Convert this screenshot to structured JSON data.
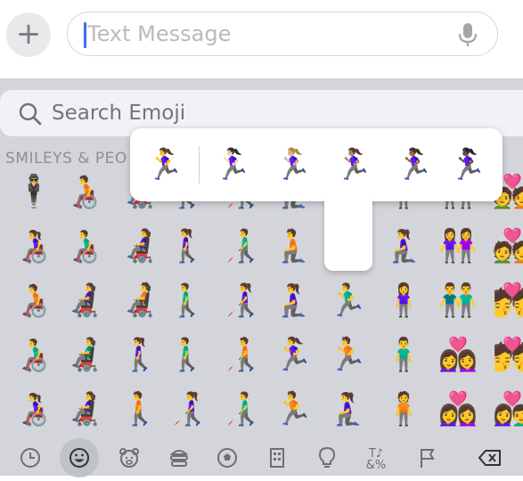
{
  "composer": {
    "plus_label": "+",
    "placeholder": "Text Message"
  },
  "emoji_keyboard": {
    "search_placeholder": "Search Emoji",
    "section_title": "SMILEYS & PEO",
    "grid": [
      [
        "🕴️",
        "🧑‍🦽",
        "👨‍🦼",
        "🚶",
        "🧑‍🦯",
        "🧎",
        "",
        "",
        "🧍",
        "👫",
        "💑"
      ],
      [
        "👩‍🦽",
        "👨‍🦽",
        "👩‍🦼",
        "🚶‍♀️",
        "👨‍🦯",
        "🧎",
        "",
        "",
        "🧎‍♀️",
        "👭",
        "💑"
      ],
      [
        "🧑‍🦽",
        "👩‍🦼",
        "🧑‍🦼",
        "🚶‍♂️",
        "👩‍🦯",
        "🧎‍♀️",
        "🏃‍♂️",
        "",
        "🧍‍♀️",
        "👬",
        "💏"
      ],
      [
        "👨‍🦽",
        "👨‍🦼",
        "🚶‍♀️",
        "🚶‍♂️",
        "🧑‍🦯",
        "🏃‍♀️",
        "🏃",
        "",
        "🧍‍♂️",
        "👩‍❤️‍👩",
        "💏"
      ],
      [
        "👩‍🦽",
        "👩‍🦼",
        "🚶",
        "👩‍🦯",
        "👨‍🦯",
        "🏃",
        "🧎‍♀️",
        "",
        "🧍",
        "👩‍❤️‍👩",
        "👩‍❤️‍👨"
      ]
    ],
    "popup_variants": [
      "🏃‍♀️",
      "🏃🏻‍♀️",
      "🏃🏼‍♀️",
      "🏃🏽‍♀️",
      "🏃🏾‍♀️",
      "🏃🏿‍♀️"
    ],
    "categories": [
      {
        "icon": "clock-icon"
      },
      {
        "icon": "smiley-icon",
        "active": true
      },
      {
        "icon": "bear-icon"
      },
      {
        "icon": "burger-icon"
      },
      {
        "icon": "soccer-ball-icon"
      },
      {
        "icon": "building-icon"
      },
      {
        "icon": "lightbulb-icon"
      },
      {
        "icon": "symbols-icon",
        "text": "T♪\n&%"
      },
      {
        "icon": "flag-icon"
      },
      {
        "icon": "backspace-icon"
      }
    ]
  },
  "colors": {
    "accent": "#3b6df3",
    "keyboard_bg": "#d3d5db"
  }
}
